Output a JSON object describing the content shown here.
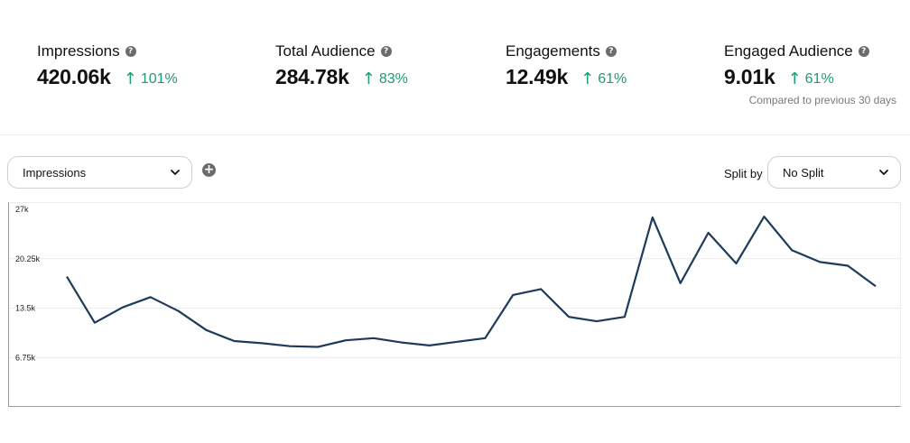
{
  "metrics": [
    {
      "label": "Impressions",
      "value": "420.06k",
      "delta": "101%",
      "trend": "up"
    },
    {
      "label": "Total Audience",
      "value": "284.78k",
      "delta": "83%",
      "trend": "up"
    },
    {
      "label": "Engagements",
      "value": "12.49k",
      "delta": "61%",
      "trend": "up"
    },
    {
      "label": "Engaged Audience",
      "value": "9.01k",
      "delta": "61%",
      "trend": "up"
    }
  ],
  "compared_text": "Compared to previous 30 days",
  "controls": {
    "metric_select": "Impressions",
    "split_label": "Split by",
    "split_select": "No Split"
  },
  "colors": {
    "accent_green": "#1a9e6b",
    "line": "#1f3a5a"
  },
  "chart_data": {
    "type": "line",
    "y_ticks": [
      "27k",
      "20.25k",
      "13.5k",
      "6.75k"
    ],
    "ylim": [
      0,
      27000
    ],
    "values": [
      17800,
      11500,
      13600,
      15000,
      13100,
      10500,
      9000,
      8700,
      8300,
      8200,
      9100,
      9400,
      8800,
      8400,
      8900,
      9400,
      15300,
      16100,
      12300,
      11700,
      12300,
      25900,
      16900,
      23800,
      19600,
      26000,
      21400,
      19800,
      19300,
      16500
    ],
    "grid": true
  }
}
